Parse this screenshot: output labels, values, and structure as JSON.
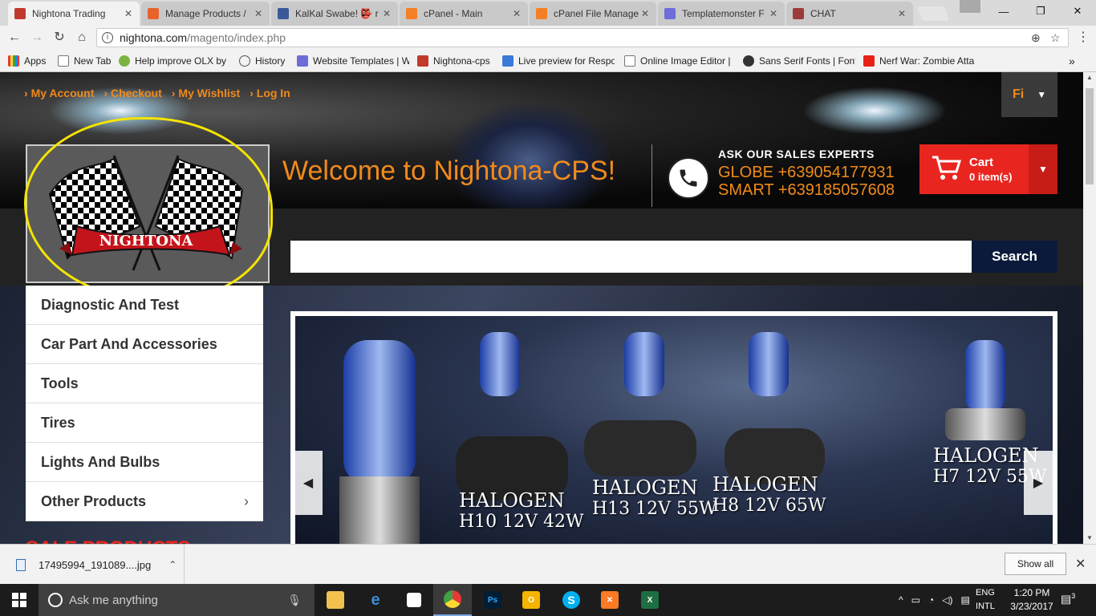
{
  "browser": {
    "tabs": [
      {
        "title": "Nightona Trading",
        "color": "#c0392b",
        "active": true
      },
      {
        "title": "Manage Products /",
        "color": "#e8632c"
      },
      {
        "title": "KalKal Swabe! 👺 r",
        "color": "#3b5998"
      },
      {
        "title": "cPanel - Main",
        "color": "#f47f24"
      },
      {
        "title": "cPanel File Manage",
        "color": "#f47f24"
      },
      {
        "title": "Templatemonster F",
        "color": "#6e6cd8"
      },
      {
        "title": "CHAT",
        "color": "#9c3b3b"
      }
    ],
    "url_host": "nightona.com",
    "url_path": "/magento/index.php",
    "bookmarks": [
      {
        "label": "Apps",
        "color": "#d33"
      },
      {
        "label": "New Tab",
        "color": "#ffffff"
      },
      {
        "label": "Help improve OLX by",
        "color": "#7cb342"
      },
      {
        "label": "History",
        "color": "#ffffff"
      },
      {
        "label": "Website Templates | W",
        "color": "#6e6cd8"
      },
      {
        "label": "Nightona-cps",
        "color": "#c0392b"
      },
      {
        "label": "Live preview for Respo",
        "color": "#3b7ad8"
      },
      {
        "label": "Online Image Editor |",
        "color": "#ffffff"
      },
      {
        "label": "Sans Serif Fonts | Font",
        "color": "#333333"
      },
      {
        "label": "Nerf War: Zombie Atta",
        "color": "#e62117"
      }
    ]
  },
  "site": {
    "top_links": [
      "My Account",
      "Checkout",
      "My Wishlist",
      "Log In"
    ],
    "language": "Fi",
    "logo_text": "NIGHTONA",
    "welcome": "Welcome to Nightona-CPS!",
    "sales": {
      "title": "ASK OUR SALES EXPERTS",
      "globe": "GLOBE +639054177931",
      "smart": "SMART +639185057608"
    },
    "cart": {
      "label": "Cart",
      "items": "0 item(s)"
    },
    "search": {
      "placeholder": "",
      "button": "Search"
    },
    "categories": [
      "Diagnostic And Test",
      "Car Part And Accessories",
      "Tools",
      "Tires",
      "Lights And Bulbs",
      "Other Products"
    ],
    "sale_heading": "SALE PRODUCTS",
    "slider": {
      "labels": [
        {
          "line1": "HALOGEN",
          "line2": "H10 12V 42W"
        },
        {
          "line1": "HALOGEN",
          "line2": "H13 12V 55W"
        },
        {
          "line1": "HALOGEN",
          "line2": "H8 12V 65W"
        },
        {
          "line1": "HALOGEN",
          "line2": "H7 12V 55W"
        }
      ]
    }
  },
  "download_bar": {
    "file": "17495994_191089....jpg",
    "show_all": "Show all"
  },
  "taskbar": {
    "search_placeholder": "Ask me anything",
    "lang1": "ENG",
    "lang2": "INTL",
    "time": "1:20 PM",
    "date": "3/23/2017",
    "notif_count": "3"
  },
  "colors": {
    "accent_orange": "#f08a1c",
    "cart_red": "#e8261f",
    "search_navy": "#0b1a3a"
  }
}
